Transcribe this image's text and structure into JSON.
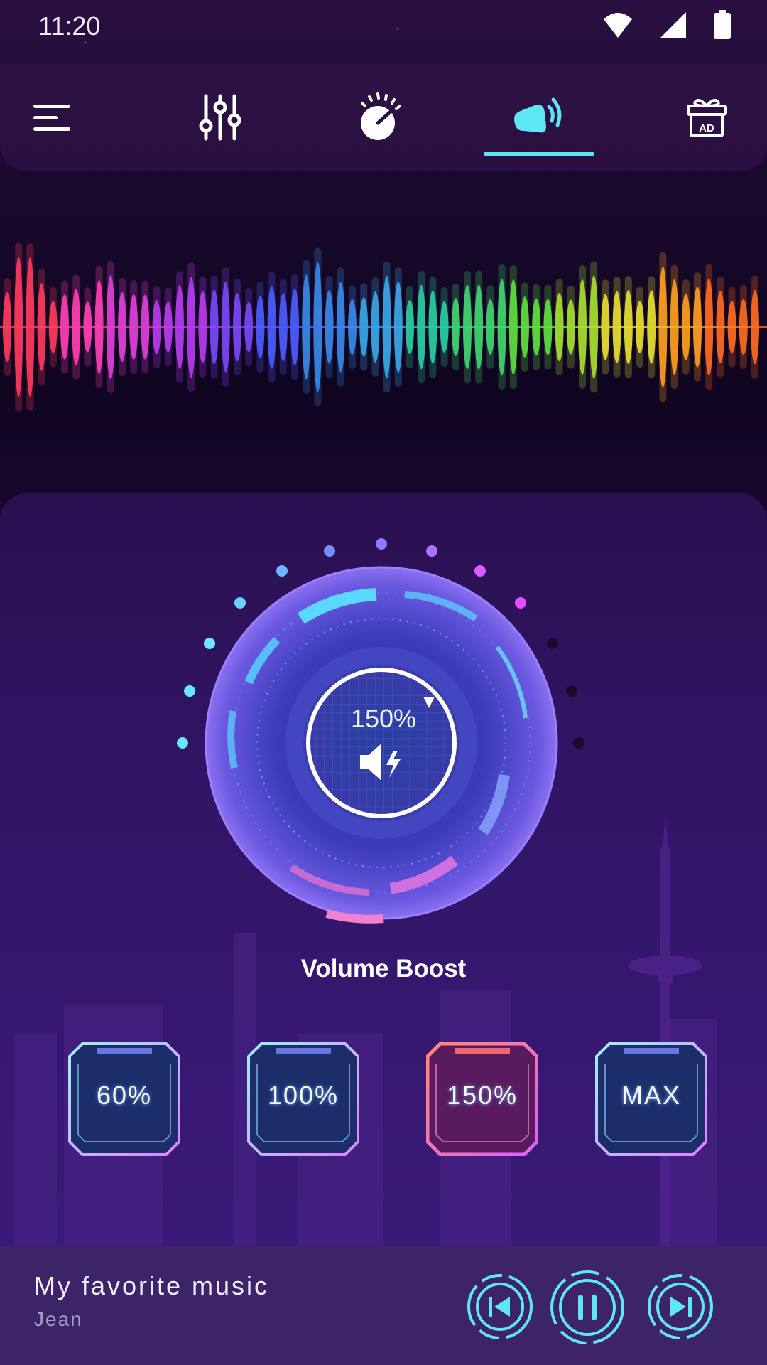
{
  "status_bar": {
    "time": "11:20"
  },
  "nav": {
    "active_index": 3,
    "items": [
      "menu-icon",
      "equalizer-icon",
      "bass-knob-icon",
      "volume-boost-icon",
      "gift-ad-icon"
    ],
    "ad_badge": "AD"
  },
  "dial": {
    "value": "150%"
  },
  "boost": {
    "title": "Volume Boost",
    "presets": [
      "60%",
      "100%",
      "150%",
      "MAX"
    ],
    "selected_preset_index": 2
  },
  "player": {
    "title": "My favorite music",
    "artist": "Jean"
  },
  "colors": {
    "accent": "#5fe6f5",
    "background": "#1b0b32",
    "player_bg": "#3d2468"
  }
}
